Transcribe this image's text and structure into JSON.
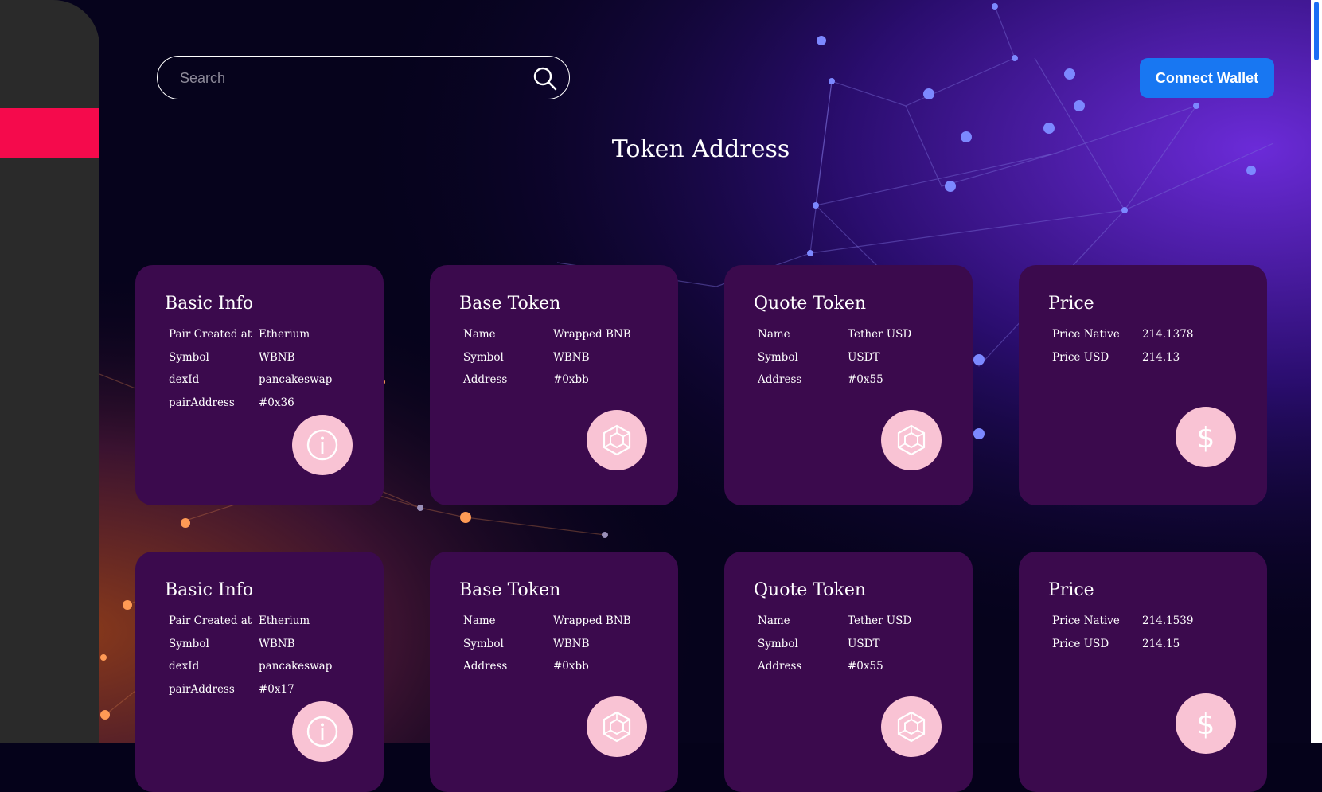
{
  "search": {
    "placeholder": "Search"
  },
  "header": {
    "connect_label": "Connect Wallet",
    "title": "Token Address"
  },
  "rows": [
    {
      "basic": {
        "title": "Basic Info",
        "pair_created_label": "Pair Created at",
        "pair_created_value": "Etherium",
        "symbol_label": "Symbol",
        "symbol_value": "WBNB",
        "dexid_label": "dexId",
        "dexid_value": "pancakeswap",
        "pair_address_label": "pairAddress",
        "pair_address_value": "#0x36"
      },
      "base": {
        "title": "Base Token",
        "name_label": "Name",
        "name_value": "Wrapped BNB",
        "symbol_label": "Symbol",
        "symbol_value": "WBNB",
        "address_label": "Address",
        "address_value": "#0xbb"
      },
      "quote": {
        "title": "Quote Token",
        "name_label": "Name",
        "name_value": "Tether USD",
        "symbol_label": "Symbol",
        "symbol_value": "USDT",
        "address_label": "Address",
        "address_value": "#0x55"
      },
      "price": {
        "title": "Price",
        "native_label": "Price Native",
        "native_value": "214.1378",
        "usd_label": "Price USD",
        "usd_value": "214.13"
      }
    },
    {
      "basic": {
        "title": "Basic Info",
        "pair_created_label": "Pair Created at",
        "pair_created_value": "Etherium",
        "symbol_label": "Symbol",
        "symbol_value": "WBNB",
        "dexid_label": "dexId",
        "dexid_value": "pancakeswap",
        "pair_address_label": "pairAddress",
        "pair_address_value": "#0x17"
      },
      "base": {
        "title": "Base Token",
        "name_label": "Name",
        "name_value": "Wrapped BNB",
        "symbol_label": "Symbol",
        "symbol_value": "WBNB",
        "address_label": "Address",
        "address_value": "#0xbb"
      },
      "quote": {
        "title": "Quote Token",
        "name_label": "Name",
        "name_value": "Tether USD",
        "symbol_label": "Symbol",
        "symbol_value": "USDT",
        "address_label": "Address",
        "address_value": "#0x55"
      },
      "price": {
        "title": "Price",
        "native_label": "Price Native",
        "native_value": "214.1539",
        "usd_label": "Price USD",
        "usd_value": "214.15"
      }
    }
  ],
  "icons": {
    "basic": "info-icon",
    "base": "hexagon-token-icon",
    "quote": "hexagon-token-icon",
    "price": "dollar-icon"
  },
  "colors": {
    "sidebar_active": "#f50a4c",
    "card_bg": "#3b0a4d",
    "badge_bg": "#f9c3d4",
    "connect_bg": "#1877f2"
  }
}
